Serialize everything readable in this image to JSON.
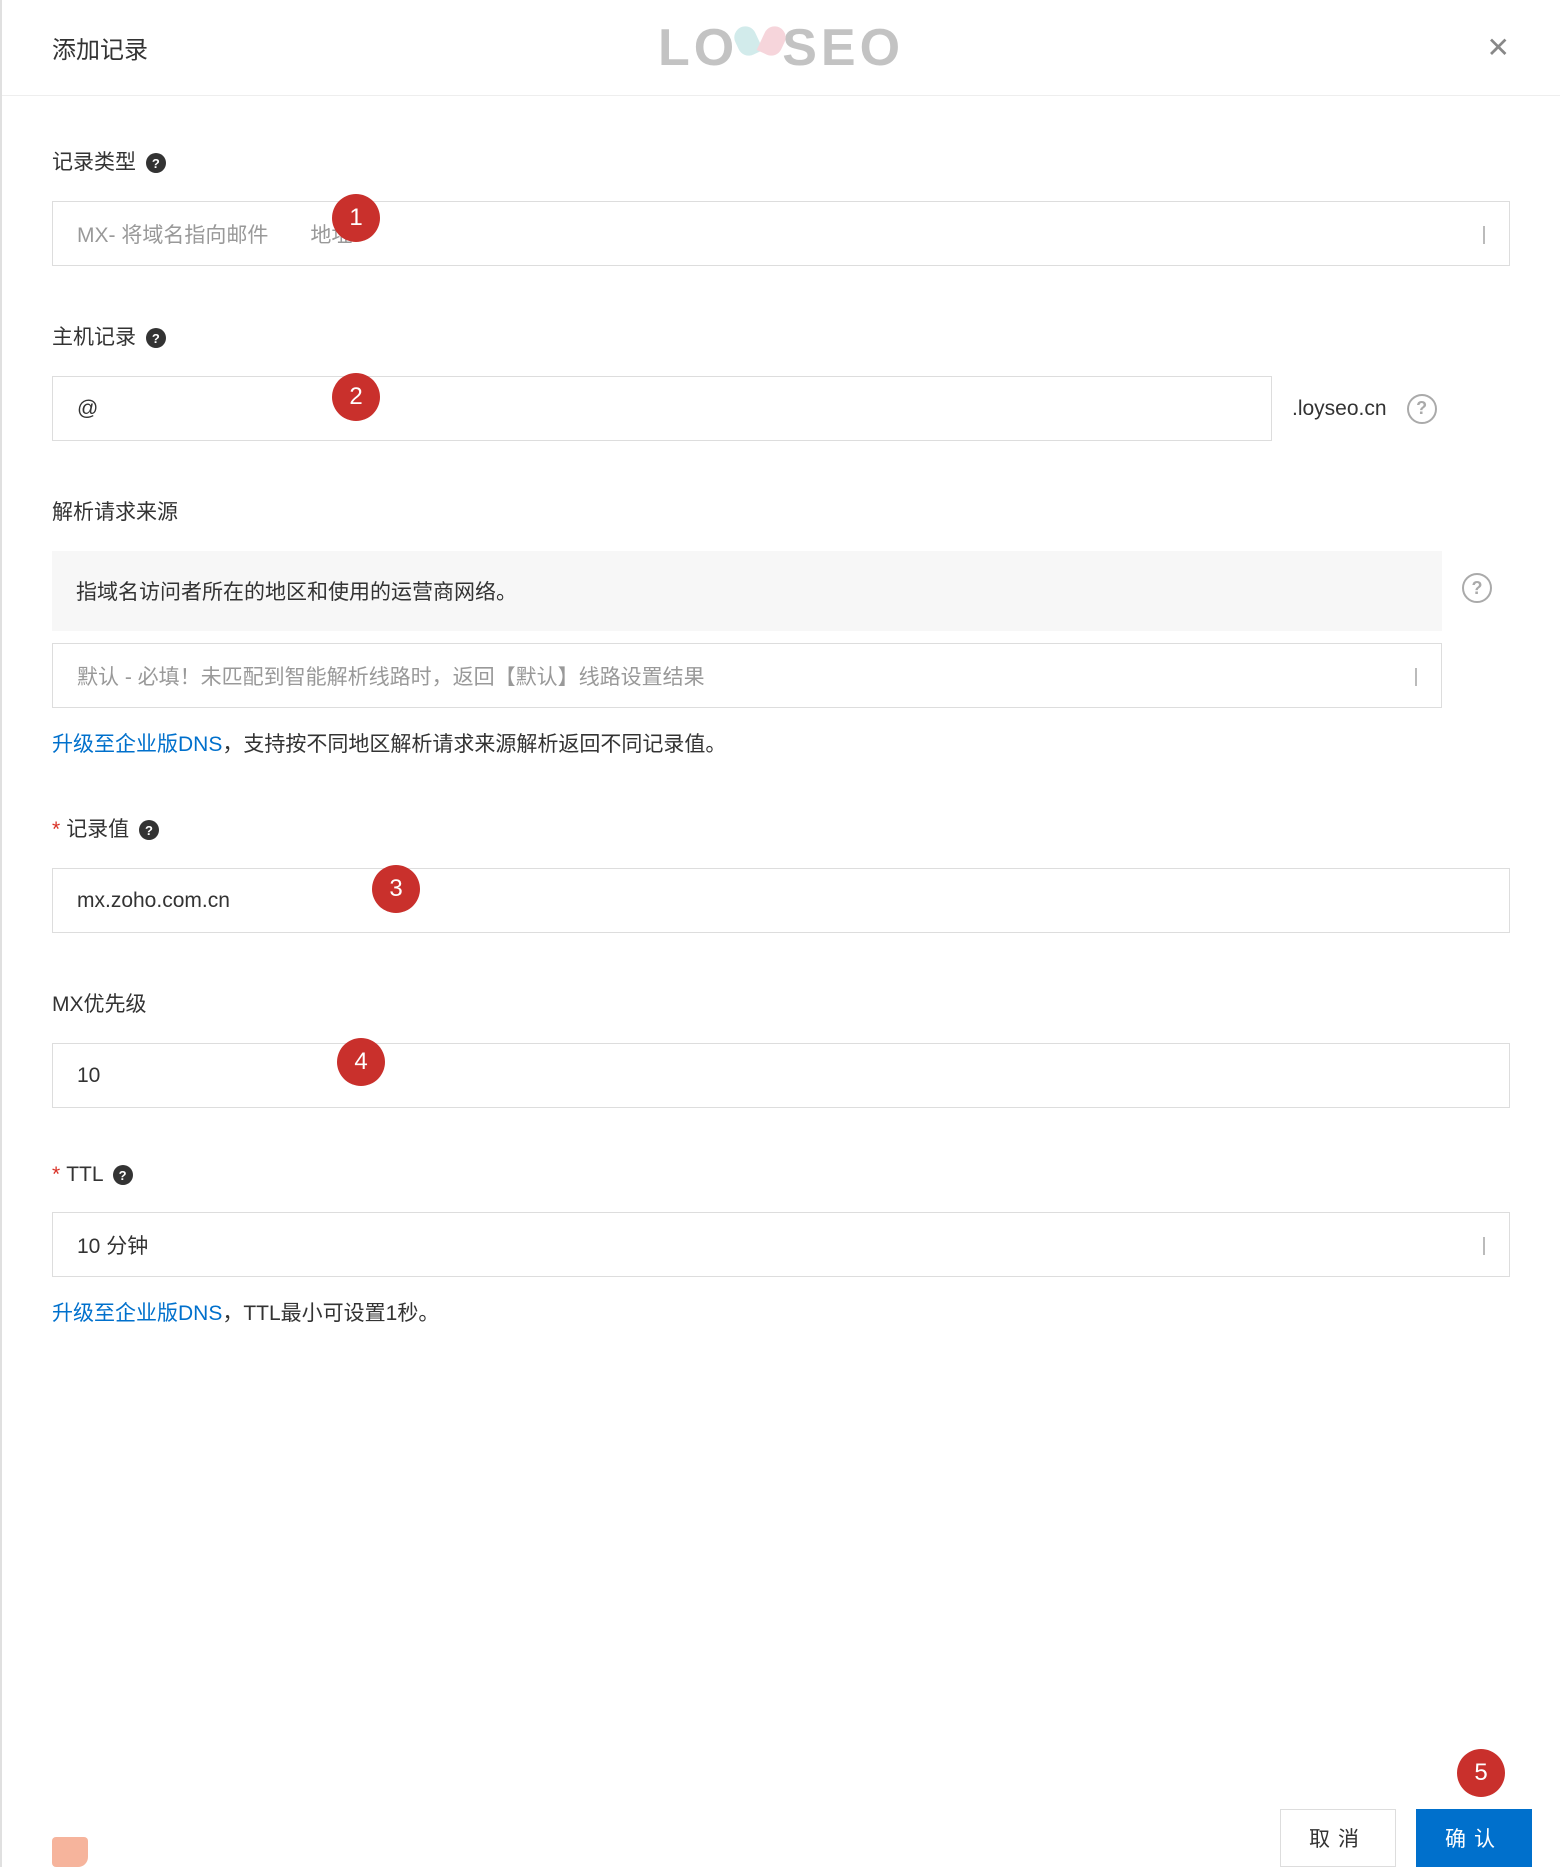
{
  "header": {
    "title": "添加记录",
    "logo_left": "LO",
    "logo_right": "SEO"
  },
  "markers": {
    "m1": "1",
    "m2": "2",
    "m3": "3",
    "m4": "4",
    "m5": "5"
  },
  "recordType": {
    "label": "记录类型",
    "value_part1": "MX- 将域名指向邮件",
    "value_part2": "地址"
  },
  "hostRecord": {
    "label": "主机记录",
    "value": "@",
    "suffix": ".loyseo.cn"
  },
  "requestSource": {
    "label": "解析请求来源",
    "tooltip": "指域名访问者所在的地区和使用的运营商网络。",
    "selectText": "默认 - 必填！未匹配到智能解析线路时，返回【默认】线路设置结果",
    "upgradeLink": "升级至企业版DNS",
    "upgradeTail": "，支持按不同地区解析请求来源解析返回不同记录值。"
  },
  "recordValue": {
    "label": "记录值",
    "value": "mx.zoho.com.cn"
  },
  "mxPriority": {
    "label": "MX优先级",
    "value": "10"
  },
  "ttl": {
    "label": "TTL",
    "value": "10 分钟",
    "upgradeLink": "升级至企业版DNS",
    "upgradeTail": "，TTL最小可设置1秒。"
  },
  "actions": {
    "cancel": "取消",
    "confirm": "确认"
  },
  "icons": {
    "help": "?",
    "helpOutline": "?"
  }
}
